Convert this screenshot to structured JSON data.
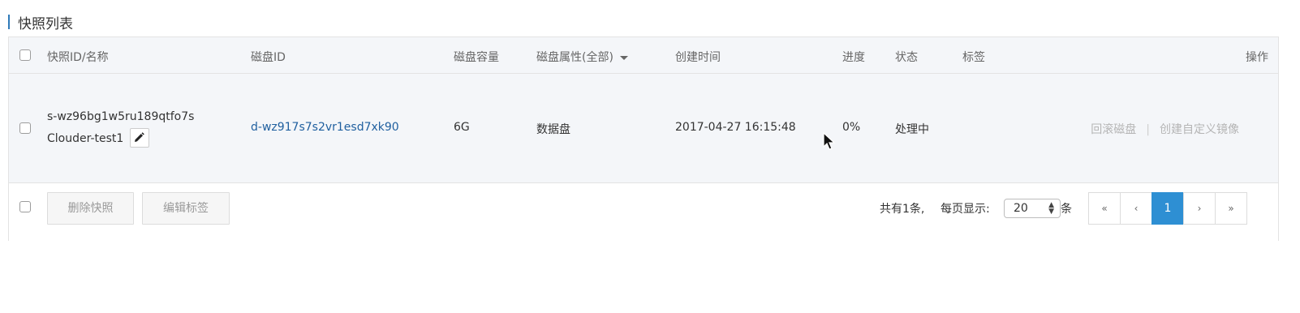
{
  "title": "快照列表",
  "table": {
    "headers": {
      "id_name": "快照ID/名称",
      "disk_id": "磁盘ID",
      "capacity": "磁盘容量",
      "attribute": "磁盘属性(全部)",
      "created": "创建时间",
      "progress": "进度",
      "status": "状态",
      "tags": "标签",
      "actions": "操作"
    },
    "rows": [
      {
        "snapshot_id": "s-wz96bg1w5ru189qtfo7s",
        "name": "Clouder-test1",
        "disk_id": "d-wz917s7s2vr1esd7xk90",
        "capacity": "6G",
        "attribute": "数据盘",
        "created": "2017-04-27 16:15:48",
        "progress": "0%",
        "status": "处理中",
        "tags": "",
        "action_rollback": "回滚磁盘",
        "action_separator": "|",
        "action_create_image": "创建自定义镜像"
      }
    ]
  },
  "footer": {
    "delete_button": "删除快照",
    "edit_tags_button": "编辑标签",
    "total_text": "共有1条,",
    "per_page_label": "每页显示:",
    "per_page_value": "20",
    "per_page_unit": "条",
    "pagination": {
      "first": "«",
      "prev": "‹",
      "current": "1",
      "next": "›",
      "last": "»"
    }
  },
  "colors": {
    "accent": "#2e8fd3",
    "link": "#1f5f9f",
    "header_bg": "#f4f6f9"
  },
  "icons": [
    "edit-pencil-icon",
    "sort-caret-icon",
    "select-arrows-icon",
    "mouse-cursor-icon"
  ]
}
